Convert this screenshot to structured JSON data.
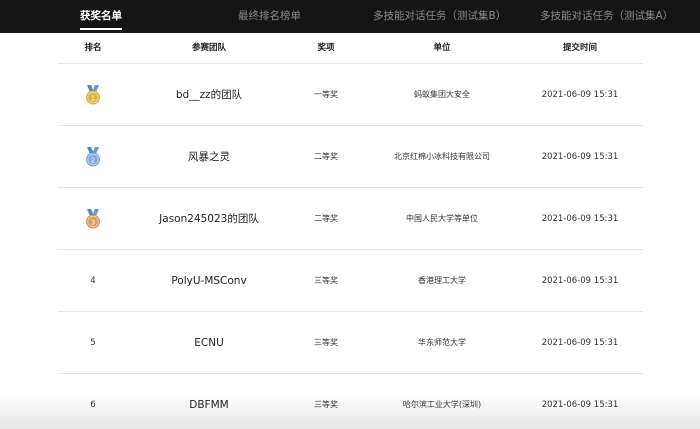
{
  "tabs": [
    {
      "label": "获奖名单",
      "active": true
    },
    {
      "label": "最终排名榜单",
      "active": false
    },
    {
      "label": "多技能对话任务（测试集B）",
      "active": false
    },
    {
      "label": "多技能对话任务（测试集A）",
      "active": false
    }
  ],
  "columns": [
    "排名",
    "参赛团队",
    "奖项",
    "单位",
    "提交时间"
  ],
  "rows": [
    {
      "rank": "1",
      "medal": "gold",
      "team": "bd__zz的团队",
      "award": "一等奖",
      "org": "蚂蚁集团大安全",
      "time": "2021-06-09 15:31"
    },
    {
      "rank": "2",
      "medal": "silver",
      "team": "风暴之灵",
      "award": "二等奖",
      "org": "北京红棉小冰科技有限公司",
      "time": "2021-06-09 15:31"
    },
    {
      "rank": "3",
      "medal": "bronze",
      "team": "Jason245023的团队",
      "award": "二等奖",
      "org": "中国人民大学等单位",
      "time": "2021-06-09 15:31"
    },
    {
      "rank": "4",
      "team": "PolyU-MSConv",
      "award": "三等奖",
      "org": "香港理工大学",
      "time": "2021-06-09 15:31"
    },
    {
      "rank": "5",
      "team": "ECNU",
      "award": "三等奖",
      "org": "华东师范大学",
      "time": "2021-06-09 15:31"
    },
    {
      "rank": "6",
      "team": "DBFMM",
      "award": "三等奖",
      "org": "哈尔滨工业大学(深圳)",
      "time": "2021-06-09 15:31"
    }
  ],
  "colors": {
    "tabbar": "#151515",
    "gold": "#e0b23a",
    "silver": "#7fa8dd",
    "bronze": "#d69a5a",
    "ribbon": "#4f86c6"
  }
}
